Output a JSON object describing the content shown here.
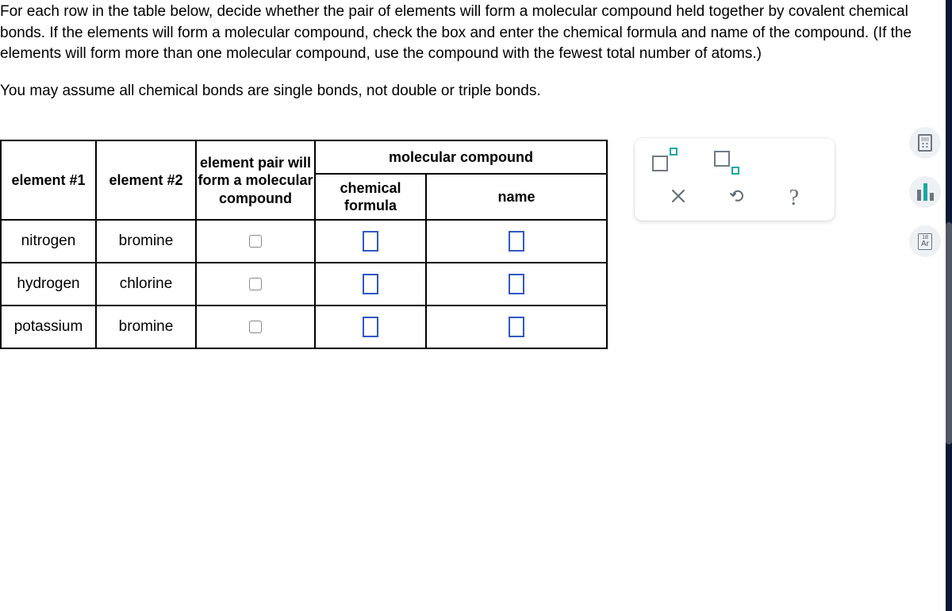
{
  "instructions": {
    "p1": "For each row in the table below, decide whether the pair of elements will form a molecular compound held together by covalent chemical bonds. If the elements will form a molecular compound, check the box and enter the chemical formula and name of the compound. (If the elements will form more than one molecular compound, use the compound with the fewest total number of atoms.)",
    "p2": "You may assume all chemical bonds are single bonds, not double or triple bonds."
  },
  "table": {
    "headers": {
      "element1": "element #1",
      "element2": "element #2",
      "pair": "element pair will form a molecular compound",
      "molcomp": "molecular compound",
      "formula": "chemical formula",
      "name": "name"
    },
    "rows": [
      {
        "e1": "nitrogen",
        "e2": "bromine"
      },
      {
        "e1": "hydrogen",
        "e2": "chlorine"
      },
      {
        "e1": "potassium",
        "e2": "bromine"
      }
    ]
  },
  "side": {
    "ar_top": "18",
    "ar_label": "Ar"
  }
}
